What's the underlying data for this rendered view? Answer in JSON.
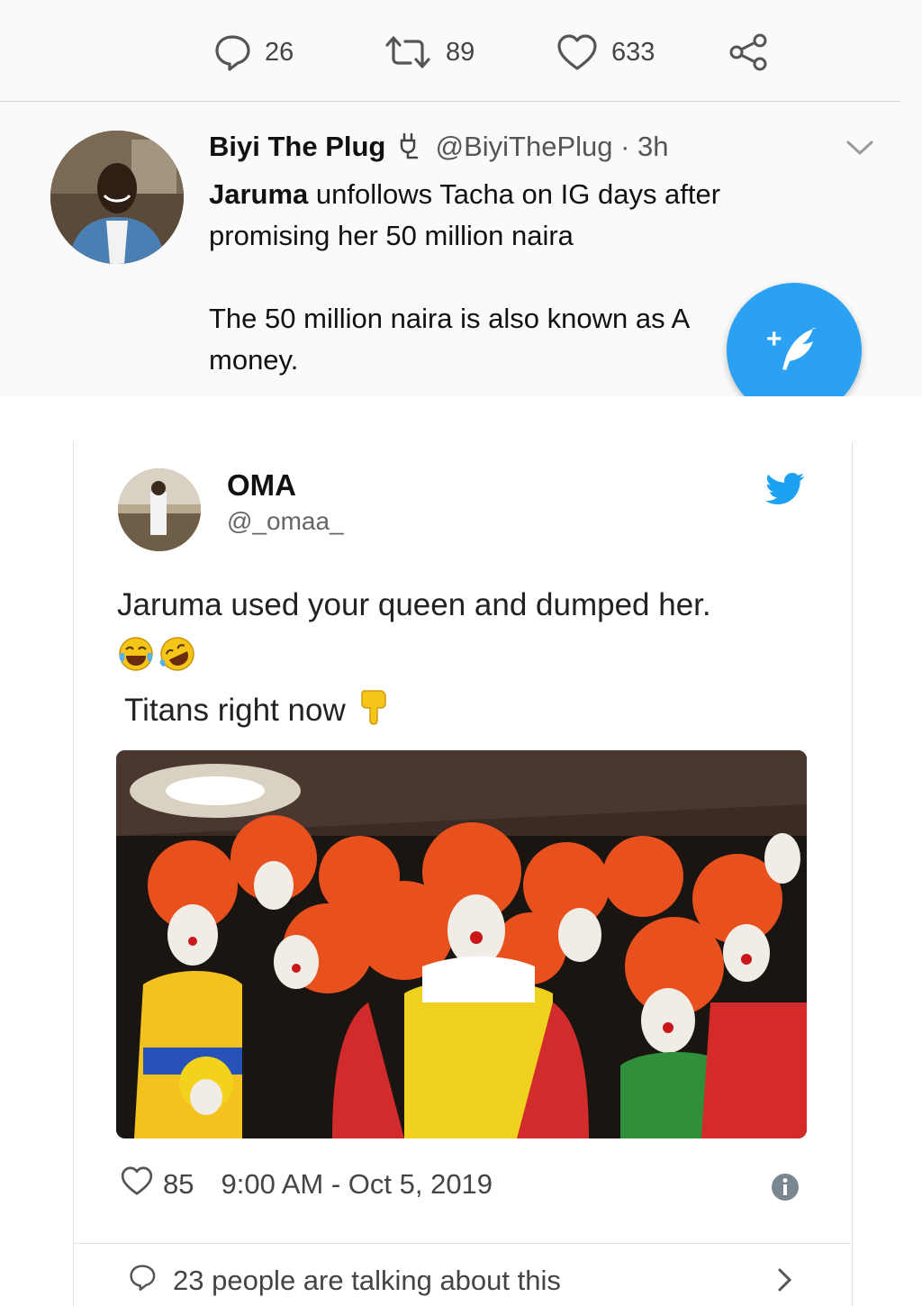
{
  "top_actions": {
    "replies": "26",
    "retweets": "89",
    "likes": "633",
    "icons": [
      "reply-icon",
      "retweet-icon",
      "like-icon",
      "share-icon"
    ]
  },
  "tweet": {
    "display_name": "Biyi The Plug",
    "handle_time": "@BiyiThePlug · 3h",
    "line1_bold": "Jaruma",
    "line1_rest": " unfollows Tacha on IG days after",
    "line2": "promising her 50 million naira",
    "line3": "The 50 million naira is also known as A",
    "line4": "money."
  },
  "compose_fab": {
    "label": "+"
  },
  "embed": {
    "name": "OMA",
    "handle": "@_omaa_",
    "text": "Jaruma used your queen and dumped her.",
    "emojis": [
      "face-with-tears-of-joy",
      "rolling-on-floor-laughing"
    ],
    "titans": "Titans right now",
    "hand_emoji": "backhand-index-pointing-down",
    "likes": "85",
    "timestamp": "9:00 AM - Oct 5, 2019",
    "talking_text": "23 people are talking about this"
  },
  "colors": {
    "accent": "#2aa1f2",
    "twitter_blue": "#1da1f2",
    "clown_hair": "#e8501d"
  }
}
